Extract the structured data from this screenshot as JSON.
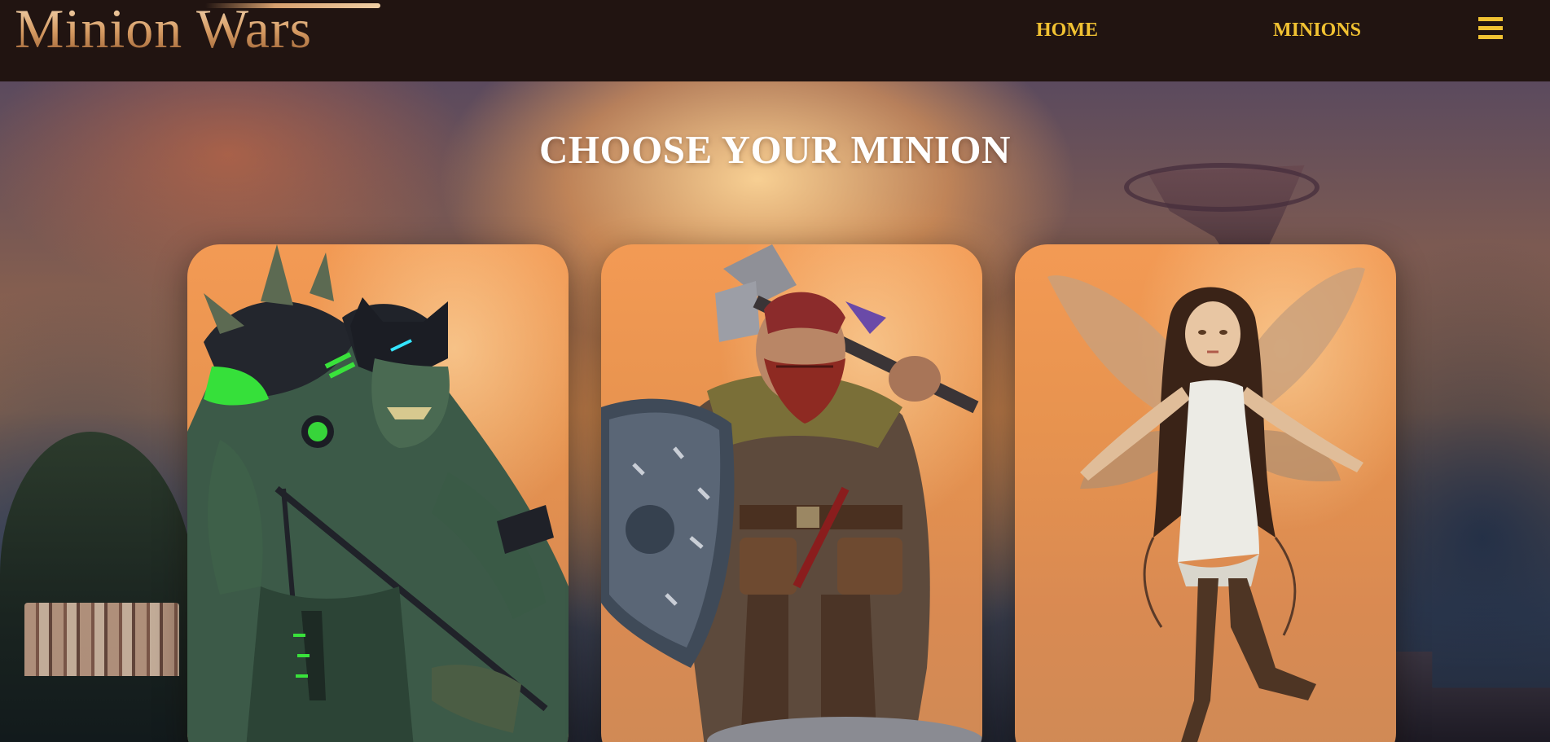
{
  "header": {
    "logo_text": "Minion Wars",
    "nav": {
      "home": "HOME",
      "minions": "MINIONS"
    },
    "menu_icon": "hamburger-menu-icon"
  },
  "main": {
    "title": "CHOOSE YOUR MINION",
    "cards": [
      {
        "kind": "orc",
        "icon": "orc-warrior-portrait"
      },
      {
        "kind": "dwarf",
        "icon": "dwarf-warrior-portrait"
      },
      {
        "kind": "fairy",
        "icon": "fairy-portrait"
      }
    ]
  },
  "colors": {
    "header_bg": "#211411",
    "nav_text": "#f1c232",
    "title_text": "#ffffff",
    "card_bg": "#ef9a55"
  }
}
